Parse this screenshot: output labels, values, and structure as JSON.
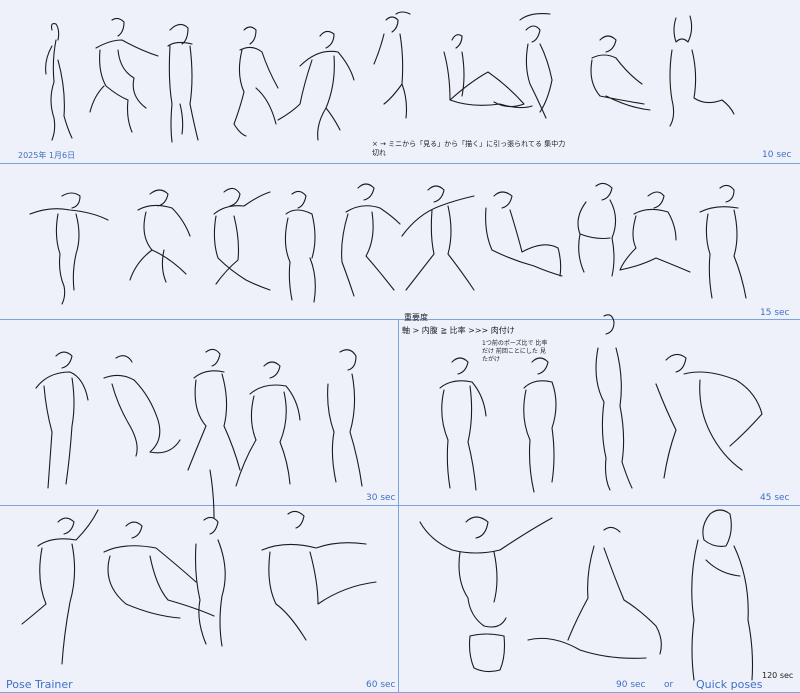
{
  "date": "2025年 1月6日",
  "rows": [
    {
      "duration": "10 sec",
      "note": "× → ミニから「見る」から「描く」に引っ張られてる 集中力 切れ"
    },
    {
      "duration": "15 sec"
    },
    {
      "duration": "30 sec"
    },
    {
      "duration": "45 sec",
      "note_title": "重要度",
      "note_line": "軸 > 内腹 ≧ 比率 >>> 肉付け",
      "note_small": "1つ前のポーズ比で 比率だけ 前回ことにした 見たがけ"
    },
    {
      "duration": "60 sec"
    },
    {
      "duration": "90 sec",
      "extra": "or",
      "footer": "Quick poses",
      "last": "120 sec"
    }
  ],
  "credit": "Pose Trainer",
  "colors": {
    "background": "#eef1f9",
    "divider": "#7aa3e0",
    "label": "#3f6fc9",
    "ink": "#1b1b1b"
  }
}
